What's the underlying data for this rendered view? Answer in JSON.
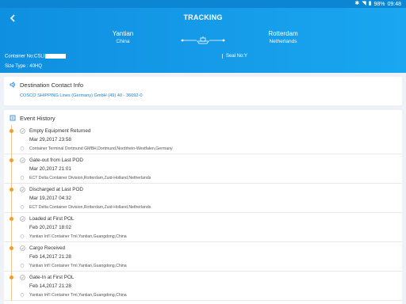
{
  "statusbar": {
    "battery": "98%",
    "time": "09:48"
  },
  "header": {
    "title": "TRACKING",
    "origin": {
      "city": "Yantian",
      "country": "China"
    },
    "destination": {
      "city": "Rotterdam",
      "country": "Netherlands"
    },
    "container_label": "Container No:CSLI",
    "seal_label": "Seal No:Y",
    "size_label": "Size Type : 40HQ"
  },
  "contact": {
    "title": "Destination Contact Info",
    "line": "COSCO SHIPPING Lines (Germany) GmbH (49) 40 - 36092-0"
  },
  "history": {
    "title": "Event History",
    "events": [
      {
        "title": "Empty Equipment Returned",
        "time": "Mar 29,2017 23:58",
        "place": "Container Terminal Dortmund GMBH,Dortmund,Nordrhein-Westfalen,Germany"
      },
      {
        "title": "Gate-out from Last POD",
        "time": "Mar 20,2017 21:01",
        "place": "ECT Delta Container Division,Rotterdam,Zuid-Holland,Netherlands"
      },
      {
        "title": "Discharged at Last POD",
        "time": "Mar 19,2017 04:32",
        "place": "ECT Delta Container Division,Rotterdam,Zuid-Holland,Netherlands"
      },
      {
        "title": "Loaded at First POL",
        "time": "Feb 20,2017 18:02",
        "place": "Yantian Int'l Container Tml,Yantian,Guangdong,China"
      },
      {
        "title": "Cargo Received",
        "time": "Feb 14,2017 21:28",
        "place": "Yantian Int'l Container Tml,Yantian,Guangdong,China"
      },
      {
        "title": "Gate-In at First POL",
        "time": "Feb 14,2017 21:28",
        "place": "Yantian Int'l Container Tml,Yantian,Guangdong,China"
      }
    ]
  },
  "colors": {
    "header": "#1199e6",
    "timeline": "#f39c2e",
    "link": "#1a7ccd"
  }
}
